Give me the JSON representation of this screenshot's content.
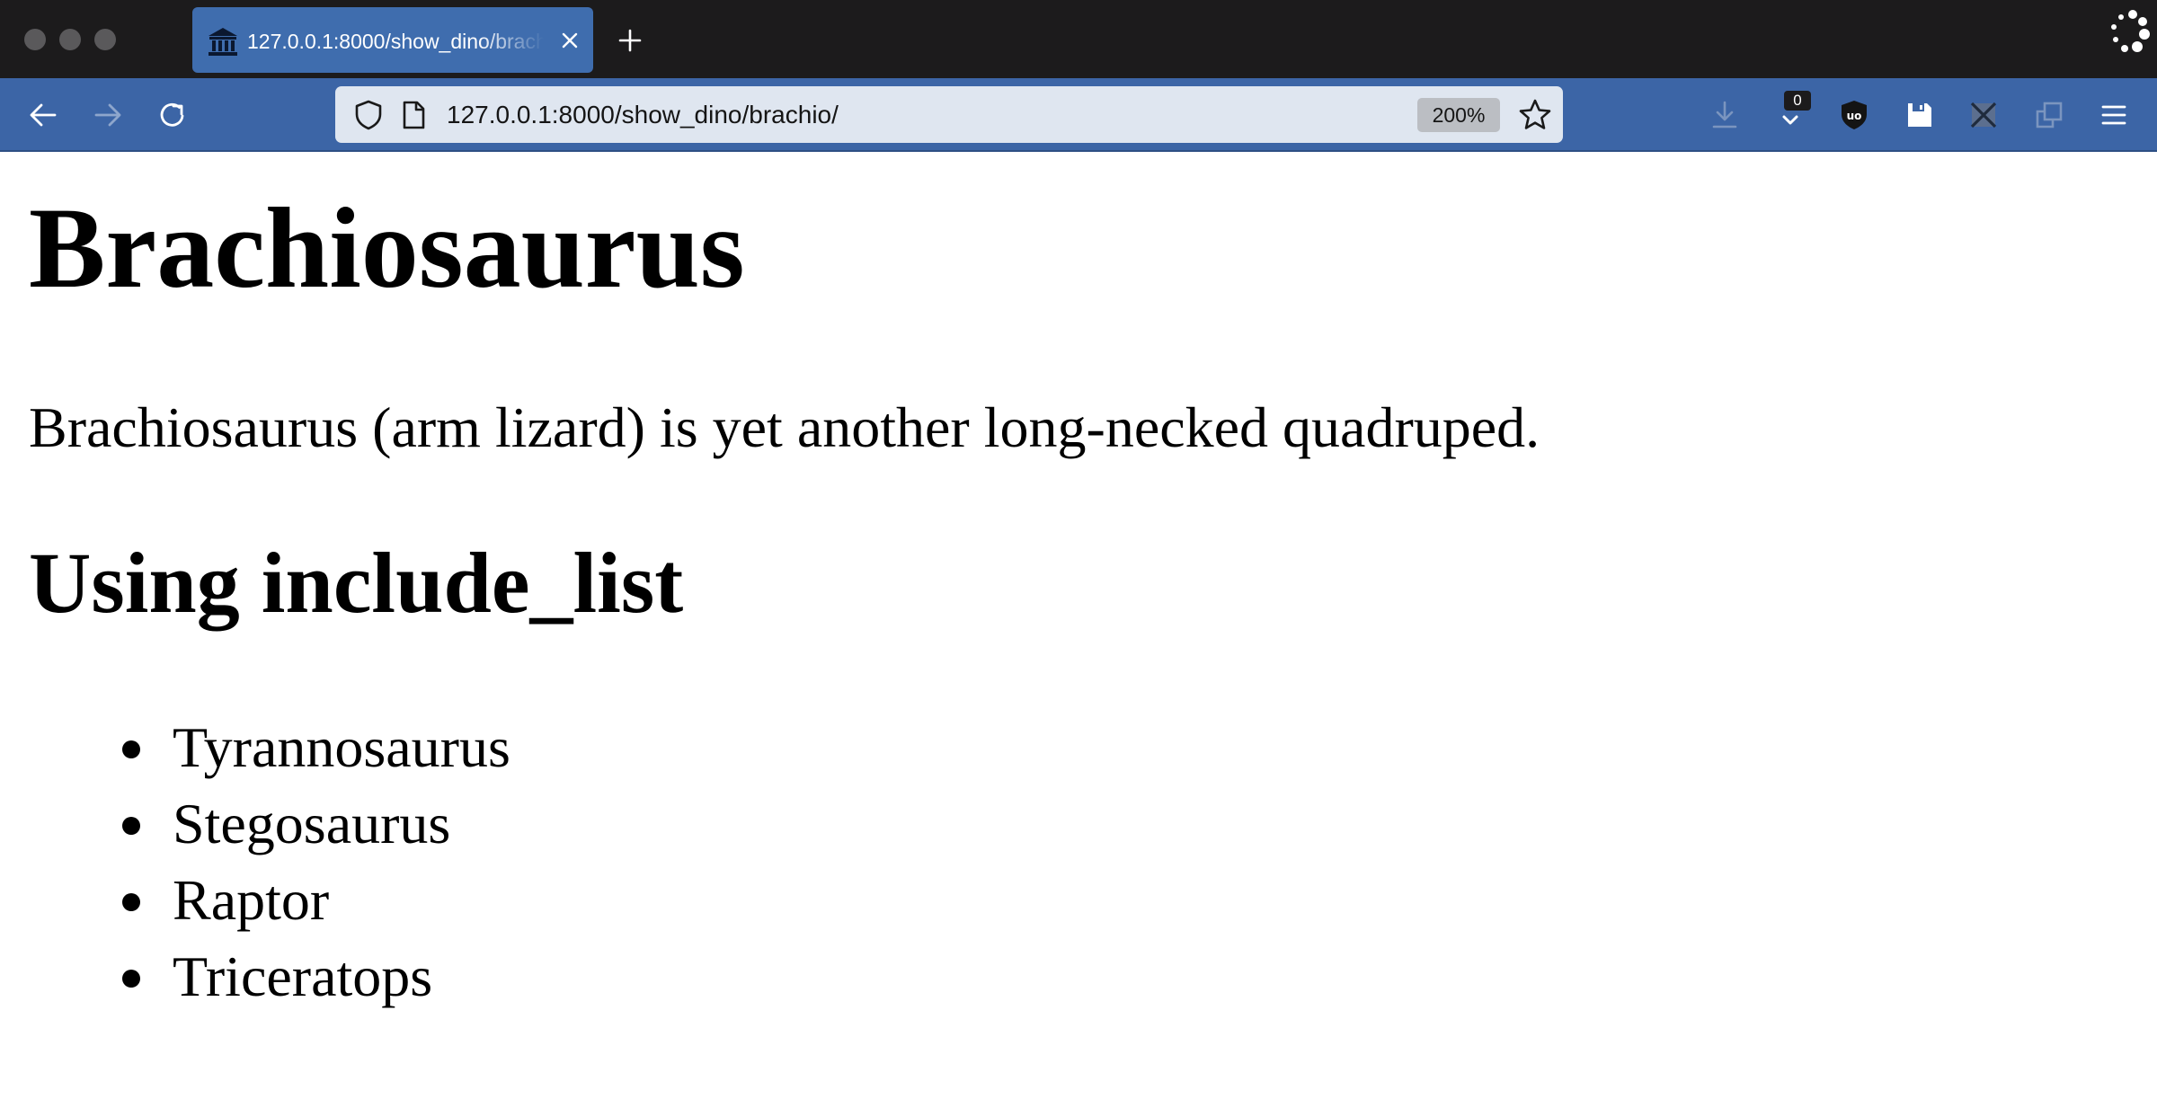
{
  "browser": {
    "tab": {
      "title": "127.0.0.1:8000/show_dino/brachio/",
      "favicon": "museum-icon"
    },
    "nav": {
      "back": "back-arrow-icon",
      "forward": "forward-arrow-icon",
      "reload": "reload-icon"
    },
    "urlbar": {
      "url": "127.0.0.1:8000/show_dino/brachio/",
      "zoom": "200%"
    },
    "toolbar": {
      "badge_count": "0",
      "icons": [
        "download-icon",
        "pocket-icon",
        "ublock-icon",
        "save-icon",
        "extension-disabled-icon",
        "window-icon",
        "hamburger-menu-icon"
      ]
    },
    "colors": {
      "tabstrip": "#1c1b1c",
      "toolbar": "#3c65a6",
      "active_tab": "#3f6dae",
      "urlbar": "#dfe6f0"
    }
  },
  "page": {
    "title": "Brachiosaurus",
    "description": "Brachiosaurus (arm lizard) is yet another long-necked quadruped.",
    "section_heading": "Using include_list",
    "items": [
      "Tyrannosaurus",
      "Stegosaurus",
      "Raptor",
      "Triceratops"
    ]
  }
}
